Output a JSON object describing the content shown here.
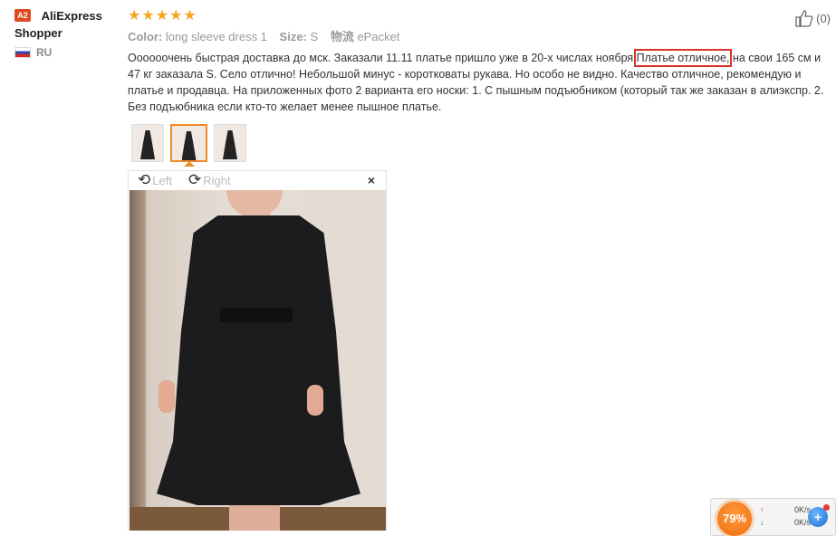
{
  "reviewer": {
    "badge": "A2",
    "name_line1": "AliExpress",
    "name_line2": "Shopper",
    "country": "RU"
  },
  "review": {
    "rating": 5,
    "star_glyph": "★",
    "meta": {
      "color_label": "Color:",
      "color_value": "long sleeve dress 1",
      "size_label": "Size:",
      "size_value": "S",
      "logistics_label": "物流",
      "logistics_value": "ePacket"
    },
    "helpful_count": "(0)",
    "text_before": "Оооооочень быстрая доставка до мск. Заказали 11.11 платье пришло уже в 20-х числах ноября.",
    "text_highlight": "Платье отличное,",
    "text_after": " на свои 165 см и 47 кг заказала S. Село отлично! Небольшой минус - коротковаты рукава. Но особо не видно. Качество отличное, рекомендую и платье и продавца. На приложенных фото 2 варианта его носки: 1. С пышным подъюбником (который так же заказан в алиэкспр. 2. Без подъюбника если кто-то желает менее пышное платье.",
    "highlight_color": "#d9322b",
    "thumbnails": [
      {
        "name": "photo-1"
      },
      {
        "name": "photo-2",
        "active": true
      },
      {
        "name": "photo-3"
      }
    ]
  },
  "viewer": {
    "rotate_left_label": "Left",
    "rotate_right_label": "Right",
    "close_glyph": "×"
  },
  "speed_widget": {
    "percent": "79%",
    "upload": "0K/s",
    "download": "0K/s",
    "boost_glyph": "+"
  },
  "colors": {
    "star": "#f5a623",
    "badge": "#e0491f",
    "thumb_active": "#f08a24"
  }
}
